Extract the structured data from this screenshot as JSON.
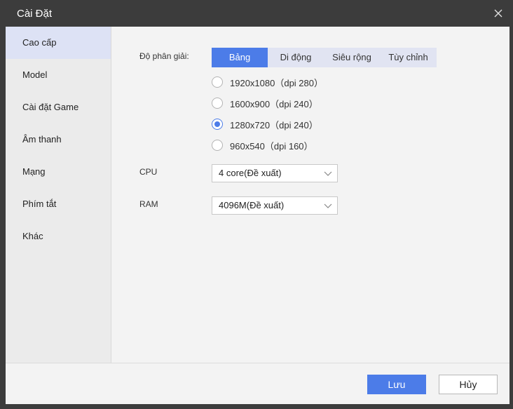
{
  "window": {
    "title": "Cài Đặt"
  },
  "sidebar": {
    "items": [
      {
        "label": "Cao cấp",
        "active": true
      },
      {
        "label": "Model"
      },
      {
        "label": "Cài đặt Game"
      },
      {
        "label": "Âm thanh"
      },
      {
        "label": "Mạng"
      },
      {
        "label": "Phím tắt"
      },
      {
        "label": "Khác"
      }
    ]
  },
  "resolution": {
    "label": "Độ phân giải:",
    "tabs": [
      {
        "label": "Bảng",
        "active": true
      },
      {
        "label": "Di động"
      },
      {
        "label": "Siêu rộng"
      },
      {
        "label": "Tùy chỉnh"
      }
    ],
    "options": [
      {
        "label": "1920x1080（dpi 280）",
        "checked": false
      },
      {
        "label": "1600x900（dpi 240）",
        "checked": false
      },
      {
        "label": "1280x720（dpi 240）",
        "checked": true
      },
      {
        "label": "960x540（dpi 160）",
        "checked": false
      }
    ]
  },
  "cpu": {
    "label": "CPU",
    "value": "4 core(Đề xuất)"
  },
  "ram": {
    "label": "RAM",
    "value": "4096M(Đề xuất)"
  },
  "footer": {
    "save_label": "Lưu",
    "cancel_label": "Hủy"
  },
  "colors": {
    "accent": "#4c7ce8",
    "titlebar": "#3c3c3c",
    "sidebar_active": "#dde2f5"
  },
  "icons": {
    "close": "close-icon",
    "dropdown": "chevron-down-icon"
  }
}
